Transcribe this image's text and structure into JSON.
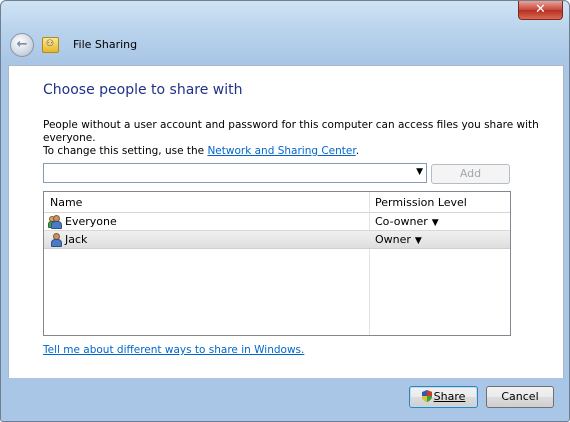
{
  "window": {
    "title": "File Sharing",
    "close_label": "✕"
  },
  "dialog": {
    "heading": "Choose people to share with",
    "info_line1": "People without a user account and password for this computer can access files you share with everyone.",
    "info_line2_prefix": "To change this setting, use the ",
    "info_link": "Network and Sharing Center",
    "info_line2_suffix": ".",
    "combo_value": "",
    "add_label": "Add",
    "columns": {
      "name": "Name",
      "permission": "Permission Level"
    },
    "rows": [
      {
        "name": "Everyone",
        "permission": "Co-owner",
        "icon": "users-group-icon"
      },
      {
        "name": "Jack",
        "permission": "Owner",
        "icon": "user-icon",
        "selected": true
      }
    ],
    "help_link": "Tell me about different ways to share in Windows.",
    "share_label": "Share",
    "cancel_label": "Cancel"
  }
}
